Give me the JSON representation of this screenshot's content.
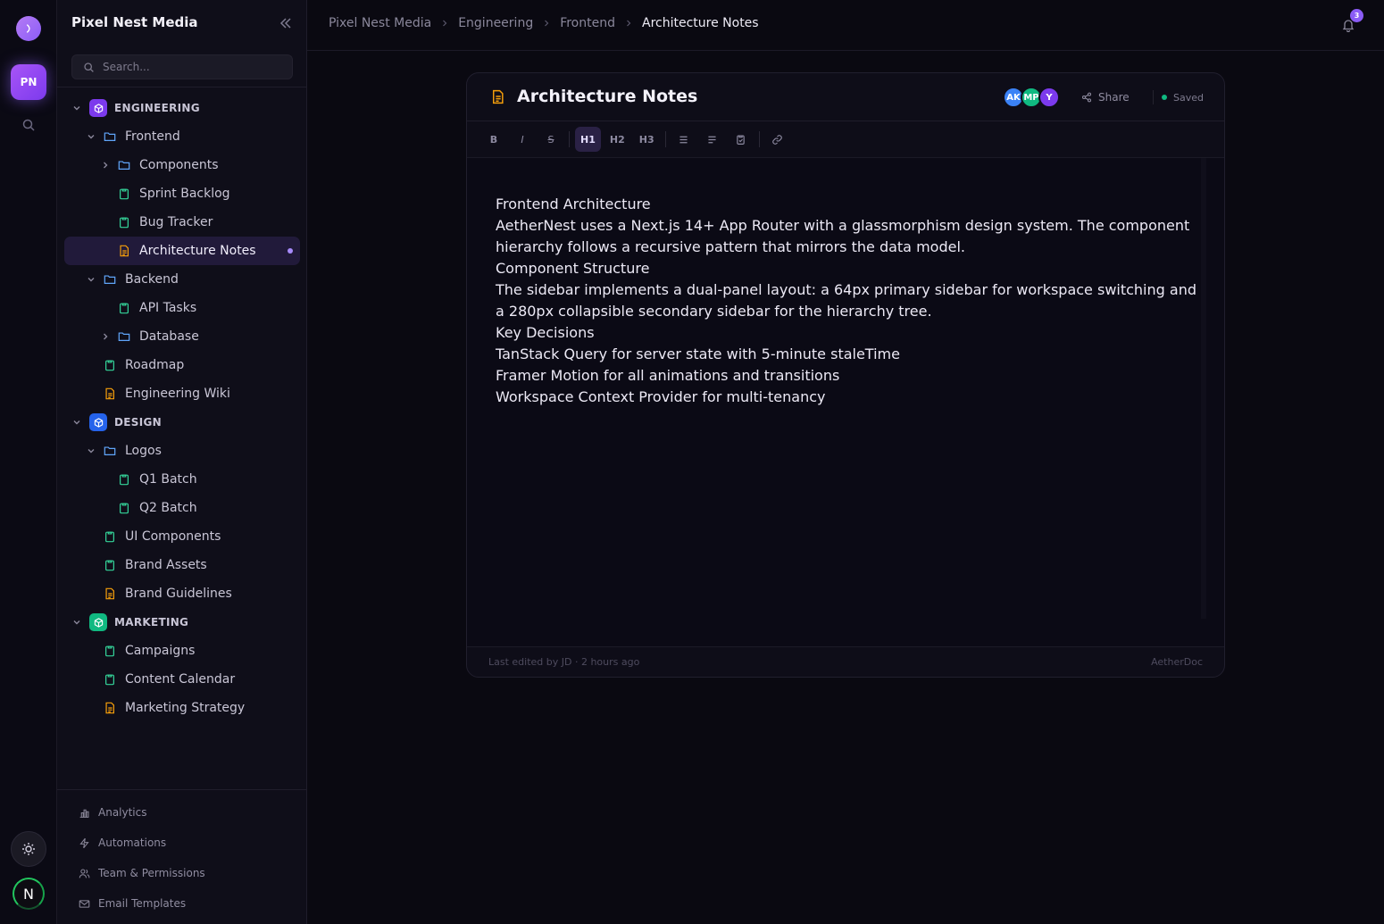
{
  "rail": {
    "workspace_initials": "PN",
    "user_initial": "N"
  },
  "sidebar": {
    "title": "Pixel Nest Media",
    "search_placeholder": "Search...",
    "tree": [
      {
        "type": "section",
        "label": "ENGINEERING",
        "color": "#7c3aed",
        "depth": 0,
        "chevron": "down"
      },
      {
        "type": "folder",
        "label": "Frontend",
        "depth": 1,
        "chevron": "down"
      },
      {
        "type": "folder",
        "label": "Components",
        "depth": 2,
        "chevron": "right"
      },
      {
        "type": "board",
        "label": "Sprint Backlog",
        "depth": 2
      },
      {
        "type": "board",
        "label": "Bug Tracker",
        "depth": 2
      },
      {
        "type": "doc",
        "label": "Architecture Notes",
        "depth": 2,
        "active": true
      },
      {
        "type": "folder",
        "label": "Backend",
        "depth": 1,
        "chevron": "down"
      },
      {
        "type": "board",
        "label": "API Tasks",
        "depth": 2
      },
      {
        "type": "folder",
        "label": "Database",
        "depth": 2,
        "chevron": "right"
      },
      {
        "type": "board",
        "label": "Roadmap",
        "depth": 1
      },
      {
        "type": "doc",
        "label": "Engineering Wiki",
        "depth": 1
      },
      {
        "type": "section",
        "label": "DESIGN",
        "color": "#2563eb",
        "depth": 0,
        "chevron": "down"
      },
      {
        "type": "folder",
        "label": "Logos",
        "depth": 1,
        "chevron": "down"
      },
      {
        "type": "board",
        "label": "Q1 Batch",
        "depth": 2
      },
      {
        "type": "board",
        "label": "Q2 Batch",
        "depth": 2
      },
      {
        "type": "board",
        "label": "UI Components",
        "depth": 1
      },
      {
        "type": "board",
        "label": "Brand Assets",
        "depth": 1
      },
      {
        "type": "doc",
        "label": "Brand Guidelines",
        "depth": 1
      },
      {
        "type": "section",
        "label": "MARKETING",
        "color": "#10b981",
        "depth": 0,
        "chevron": "down"
      },
      {
        "type": "board",
        "label": "Campaigns",
        "depth": 1
      },
      {
        "type": "board",
        "label": "Content Calendar",
        "depth": 1
      },
      {
        "type": "doc",
        "label": "Marketing Strategy",
        "depth": 1
      }
    ],
    "bottom": [
      {
        "label": "Analytics",
        "icon": "bar-chart-icon"
      },
      {
        "label": "Automations",
        "icon": "zap-icon"
      },
      {
        "label": "Team & Permissions",
        "icon": "users-icon"
      },
      {
        "label": "Email Templates",
        "icon": "mail-icon"
      }
    ]
  },
  "topbar": {
    "breadcrumbs": [
      "Pixel Nest Media",
      "Engineering",
      "Frontend",
      "Architecture Notes"
    ],
    "notification_count": "3"
  },
  "doc": {
    "title": "Architecture Notes",
    "avatars": [
      {
        "initials": "AK",
        "color": "#3b82f6"
      },
      {
        "initials": "MP",
        "color": "#10b981"
      },
      {
        "initials": "Y",
        "color": "#7c3aed"
      }
    ],
    "share_label": "Share",
    "status": "Saved",
    "toolbar": {
      "bold": "B",
      "italic": "I",
      "strike": "S",
      "h1": "H1",
      "h2": "H2",
      "h3": "H3"
    },
    "content": [
      "Frontend Architecture",
      "AetherNest uses a Next.js 14+ App Router with a glassmorphism design system. The component hierarchy follows a recursive pattern that mirrors the data model.",
      "Component Structure",
      "The sidebar implements a dual-panel layout: a 64px primary sidebar for workspace switching and a 280px collapsible secondary sidebar for the hierarchy tree.",
      "Key Decisions",
      "TanStack Query for server state with 5-minute staleTime",
      "Framer Motion for all animations and transitions",
      "Workspace Context Provider for multi-tenancy"
    ],
    "footer_left": "Last edited by JD · 2 hours ago",
    "footer_right": "AetherDoc"
  }
}
